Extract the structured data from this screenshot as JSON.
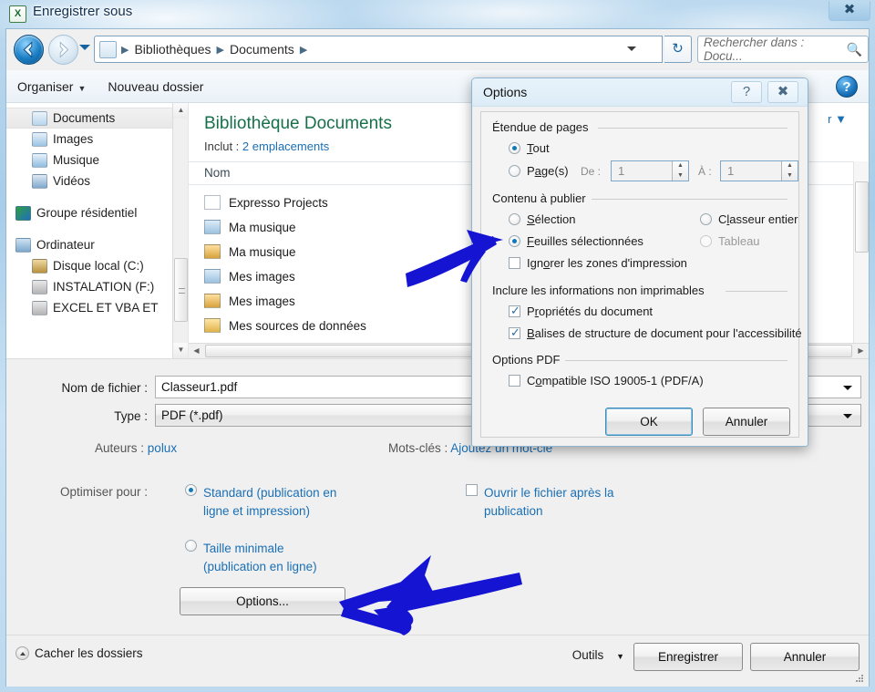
{
  "window": {
    "title": "Enregistrer sous",
    "app_icon": "excel-icon",
    "close_label": "✖"
  },
  "nav": {
    "back_label": "back-arrow",
    "forward_label": "forward-arrow",
    "breadcrumbs": [
      "Bibliothèques",
      "Documents"
    ],
    "refresh_label": "↻",
    "search_placeholder": "Rechercher dans : Docu...",
    "search_value": ""
  },
  "command_bar": {
    "organize": "Organiser",
    "new_folder": "Nouveau dossier",
    "help": "?"
  },
  "sidebar": {
    "items": [
      {
        "label": "Documents",
        "icon": "documents-library-icon",
        "selected": true,
        "level": 1
      },
      {
        "label": "Images",
        "icon": "pictures-library-icon",
        "selected": false,
        "level": 1
      },
      {
        "label": "Musique",
        "icon": "music-library-icon",
        "selected": false,
        "level": 1
      },
      {
        "label": "Vidéos",
        "icon": "videos-library-icon",
        "selected": false,
        "level": 1
      },
      {
        "label": "Groupe résidentiel",
        "icon": "homegroup-icon",
        "selected": false,
        "level": 0
      },
      {
        "label": "Ordinateur",
        "icon": "computer-icon",
        "selected": false,
        "level": 0
      },
      {
        "label": "Disque local (C:)",
        "icon": "harddisk-icon",
        "selected": false,
        "level": 1
      },
      {
        "label": "INSTALATION (F:)",
        "icon": "drive-icon",
        "selected": false,
        "level": 1
      },
      {
        "label": "EXCEL ET VBA ET",
        "icon": "drive-icon",
        "selected": false,
        "level": 1
      }
    ]
  },
  "file_pane": {
    "library_title": "Bibliothèque Documents",
    "includes_label": "Inclut :",
    "includes_link": "2 emplacements",
    "column_header": "Nom",
    "view_dropdown": "r",
    "files": [
      {
        "name": "Expresso Projects",
        "icon": "folder-icon"
      },
      {
        "name": "Ma musique",
        "icon": "shortcut-folder-icon"
      },
      {
        "name": "Ma musique",
        "icon": "locked-folder-icon"
      },
      {
        "name": "Mes images",
        "icon": "shortcut-folder-icon"
      },
      {
        "name": "Mes images",
        "icon": "locked-folder-icon"
      },
      {
        "name": "Mes sources de données",
        "icon": "datasource-folder-icon"
      }
    ]
  },
  "save_form": {
    "filename_label": "Nom de fichier :",
    "filename_value": "Classeur1.pdf",
    "type_label": "Type :",
    "type_value": "PDF (*.pdf)",
    "authors_label": "Auteurs :",
    "authors_value": "polux",
    "keywords_label": "Mots-clés :",
    "keywords_value": "Ajoutez un mot-clé",
    "optimize_label": "Optimiser pour :",
    "optimize_options": [
      {
        "label": "Standard (publication en ligne et impression)",
        "selected": true
      },
      {
        "label": "Taille minimale (publication en ligne)",
        "selected": false
      }
    ],
    "open_after_label": "Ouvrir le fichier après la publication",
    "open_after_checked": false,
    "options_button": "Options..."
  },
  "status_bar": {
    "hide_folders": "Cacher les dossiers",
    "tools": "Outils",
    "save": "Enregistrer",
    "cancel": "Annuler"
  },
  "dialog": {
    "title": "Options",
    "help_glyph": "?",
    "close_glyph": "✖",
    "groups": {
      "page_range": {
        "label": "Étendue de pages",
        "all": {
          "label": "Tout",
          "underline": "T",
          "selected": true
        },
        "pages": {
          "label": "Page(s)",
          "underline": "a",
          "selected": false
        },
        "from_label": "De :",
        "from_value": "1",
        "to_label": "À :",
        "to_value": "1"
      },
      "content": {
        "label": "Contenu à publier",
        "selection": {
          "label": "Sélection",
          "selected": false,
          "disabled": false
        },
        "sheets": {
          "label": "Feuilles sélectionnées",
          "selected": true,
          "disabled": false
        },
        "workbook": {
          "label": "Classeur entier",
          "selected": false,
          "disabled": false
        },
        "table": {
          "label": "Tableau",
          "selected": false,
          "disabled": true
        },
        "ignore_print_areas": {
          "label": "Ignorer les zones d'impression",
          "checked": false
        }
      },
      "non_printable": {
        "label": "Inclure les informations non imprimables",
        "doc_properties": {
          "label": "Propriétés du document",
          "checked": true
        },
        "structure_tags": {
          "label": "Balises de structure de document pour l'accessibilité",
          "checked": true
        }
      },
      "pdf_options": {
        "label": "Options PDF",
        "iso": {
          "label": "Compatible ISO 19005-1 (PDF/A)",
          "checked": false
        }
      }
    },
    "ok": "OK",
    "cancel": "Annuler"
  },
  "annotations": {
    "arrow_color": "#1414d2",
    "arrow_1_target": "feuilles-selectionnees-radio",
    "arrow_2_target": "options-button"
  }
}
